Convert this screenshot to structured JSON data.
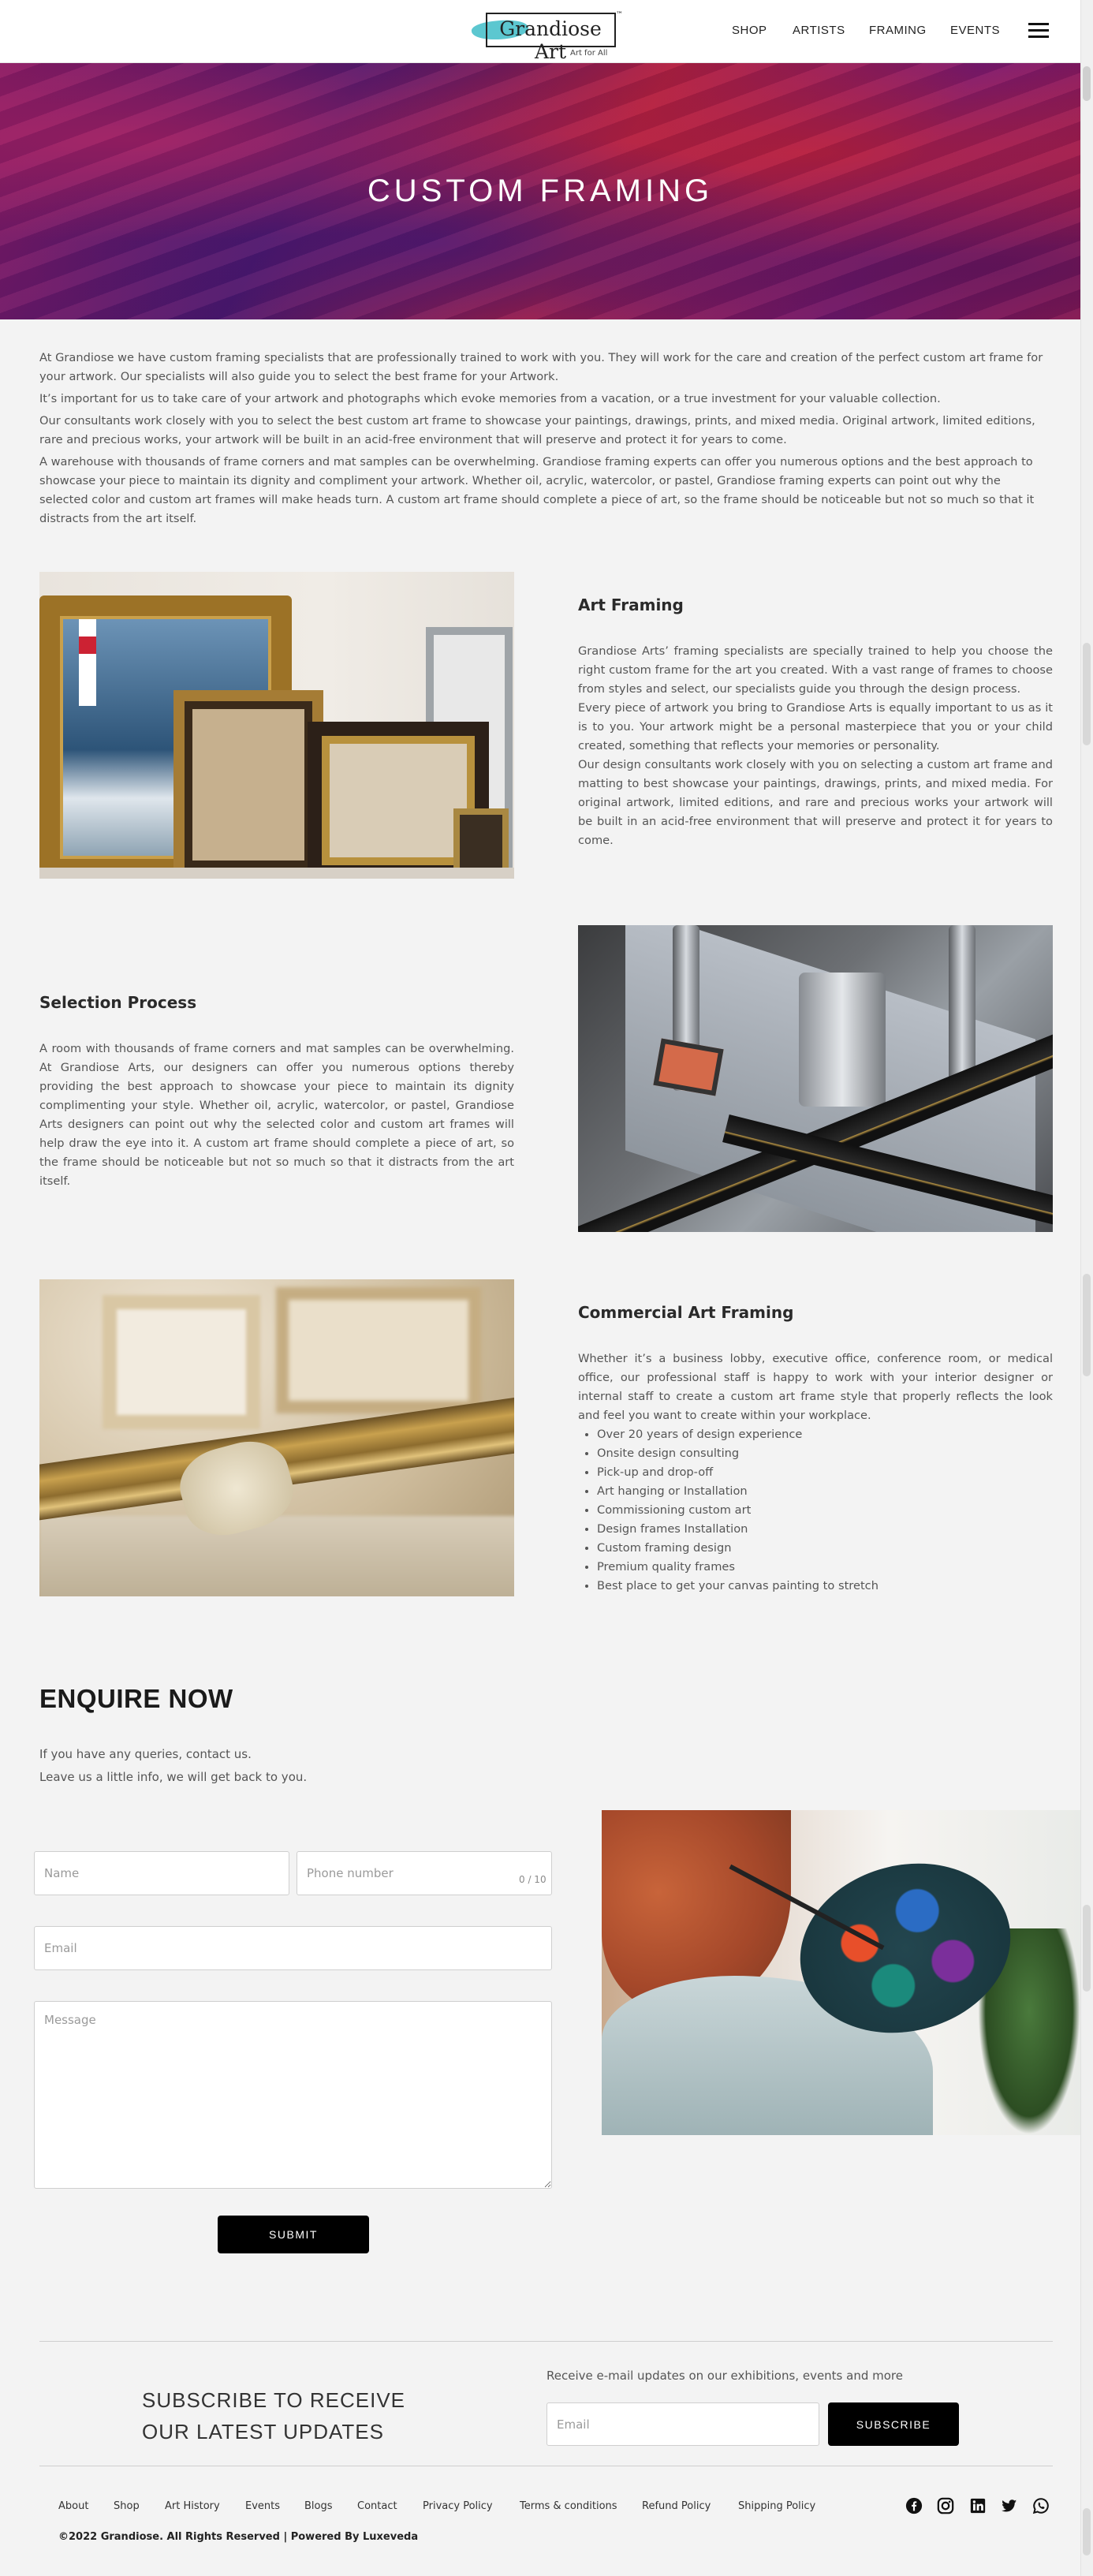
{
  "header": {
    "logo_text": "Grandiose Art",
    "logo_tm": "™",
    "logo_tagline": "Art for All",
    "nav": [
      "SHOP",
      "ARTISTS",
      "FRAMING",
      "EVENTS"
    ]
  },
  "hero": {
    "title": "CUSTOM FRAMING"
  },
  "intro": {
    "paragraphs": [
      "At Grandiose we have custom framing specialists that are professionally trained to work with you. They will work for the care and creation of the perfect custom art frame for your artwork. Our specialists will also guide you to select the best frame for your Artwork.",
      "It’s important for us to take care of your artwork and photographs which evoke memories from a vacation, or a true investment for your valuable collection.",
      "Our consultants work closely with you to select the best custom art frame to showcase your paintings, drawings, prints, and mixed media. Original artwork, limited editions, rare and precious works, your artwork will be built in an acid-free environment that will preserve and protect it for years to come.",
      "A warehouse with thousands of frame corners and mat samples can be overwhelming. Grandiose framing experts can offer you numerous options and the best approach to showcase your piece to maintain its dignity and compliment your artwork. Whether oil, acrylic, watercolor, or pastel, Grandiose framing experts can point out why the selected color and custom art frames will make heads turn. A custom art frame should complete a piece of art, so the frame should be noticeable but not so much so that it distracts from the art itself."
    ]
  },
  "art_framing": {
    "title": "Art Framing",
    "paragraphs": [
      "Grandiose Arts’ framing specialists are specially trained to help you choose the right custom frame for the art you created. With a vast range of frames to choose from styles and select, our specialists guide you through the design process.",
      "Every piece of artwork you bring to Grandiose Arts is equally important to us as it is to you. Your artwork might be a personal masterpiece that you or your child created, something that reflects your memories or personality.",
      "Our design consultants work closely with you on selecting a custom art frame and matting to best showcase your paintings, drawings, prints, and mixed media. For original artwork, limited editions, and rare and precious works your artwork will be built in an acid-free environment that will preserve and protect it for years to come."
    ]
  },
  "selection": {
    "title": "Selection Process",
    "paragraph": "A room with thousands of frame corners and mat samples can be overwhelming. At Grandiose Arts, our designers can offer you numerous options thereby providing the best approach to showcase your piece to maintain its dignity complimenting your style. Whether oil, acrylic, watercolor, or pastel, Grandiose Arts designers can point out why the selected color and custom art frames will help draw the eye into it. A custom art frame should complete a piece of art, so the frame should be noticeable but not so much so that it distracts from the art itself."
  },
  "commercial": {
    "title": "Commercial Art Framing",
    "paragraph": "Whether it’s a business lobby, executive office, conference room, or medical office, our professional staff is happy to work with your interior designer or internal staff to create a custom art frame style that properly reflects the look and feel you want to create within your workplace.",
    "bullets": [
      "Over 20 years of design experience",
      "Onsite design consulting",
      "Pick-up and drop-off",
      "Art hanging or Installation",
      "Commissioning custom art",
      "Design frames Installation",
      "Custom framing design",
      "Premium quality frames",
      "Best place to get your canvas painting to stretch"
    ]
  },
  "enquire": {
    "title": "ENQUIRE NOW",
    "line1": "If you have any queries, contact us.",
    "line2": "Leave us a little info, we will get back to you.",
    "name_placeholder": "Name",
    "phone_placeholder": "Phone number",
    "counter": "0 / 10",
    "email_placeholder": "Email",
    "message_placeholder": "Message",
    "submit": "SUBMIT"
  },
  "subscribe": {
    "title_line1": "SUBSCRIBE TO RECEIVE",
    "title_line2": "OUR LATEST UPDATES",
    "text": "Receive e-mail updates on our exhibitions, events and more",
    "email_placeholder": "Email",
    "button": "SUBSCRIBE"
  },
  "footer": {
    "links": [
      "About",
      "Shop",
      "Art History",
      "Events",
      "Blogs",
      "Contact",
      "Privacy Policy",
      "Terms & conditions",
      "Refund Policy",
      "Shipping Policy"
    ],
    "copyright": "©2022 Grandiose. All Rights Reserved | Powered By Luxeveda",
    "social_icons": [
      "facebook-icon",
      "instagram-icon",
      "linkedin-icon",
      "twitter-icon",
      "whatsapp-icon"
    ]
  }
}
